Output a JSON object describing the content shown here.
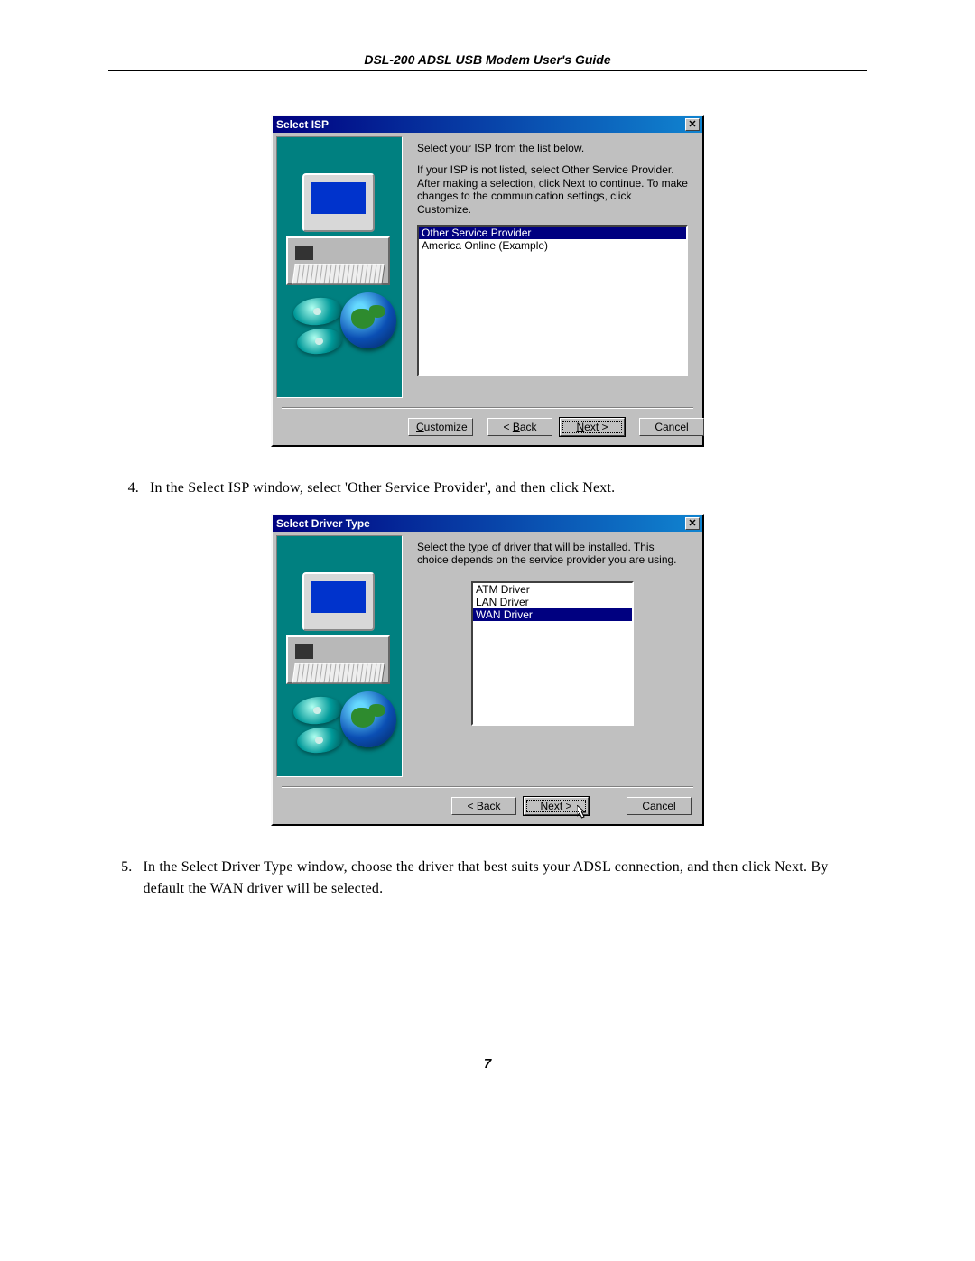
{
  "header": {
    "title": "DSL-200 ADSL USB Modem User's Guide"
  },
  "page_number": "7",
  "dialog1": {
    "title": "Select ISP",
    "line1": "Select your ISP from the list below.",
    "line2": "If your ISP is not listed, select Other Service Provider.  After making a selection, click Next to continue.  To make changes to the communication settings, click Customize.",
    "options": {
      "selected": "Other Service Provider",
      "unselected": "America Online (Example)"
    },
    "buttons": {
      "customize": "Customize",
      "back": "< Back",
      "next": "Next >",
      "cancel": "Cancel"
    }
  },
  "step4": {
    "num": "4.",
    "text": "In the Select ISP window, select 'Other Service Provider', and then click Next."
  },
  "dialog2": {
    "title": "Select Driver Type",
    "line1": "Select the type of driver that will be installed.  This choice depends on the service provider you are using.",
    "options": {
      "o1": "ATM Driver",
      "o2": "LAN Driver",
      "selected": "WAN Driver"
    },
    "buttons": {
      "back": "< Back",
      "next": "Next >",
      "cancel": "Cancel"
    }
  },
  "step5": {
    "num": "5.",
    "text": "In the Select Driver Type window, choose the driver that best suits your ADSL connection, and then click Next. By default the WAN driver will be selected."
  }
}
